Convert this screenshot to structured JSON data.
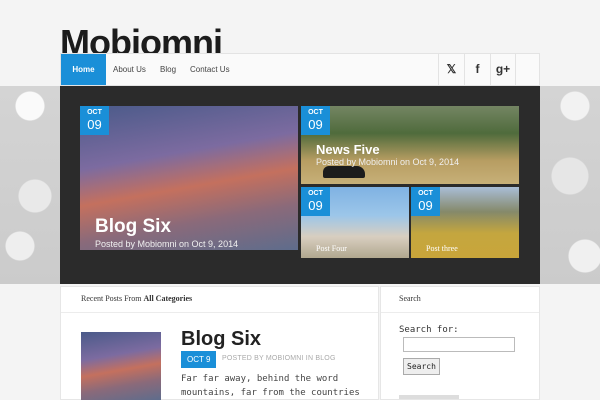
{
  "site": {
    "title": "Mobiomni"
  },
  "nav": {
    "items": [
      "Home",
      "About Us",
      "Blog",
      "Contact Us"
    ]
  },
  "social": {
    "icons": [
      "twitter-icon",
      "facebook-icon",
      "google-plus-icon"
    ],
    "glyphs": [
      "𝕏",
      "f",
      "g+"
    ]
  },
  "colors": {
    "accent": "#1a8fd8",
    "slider_bg": "#2b2b2b"
  },
  "slider": {
    "main": {
      "month": "OCT",
      "day": "09",
      "title": "Blog Six",
      "meta": "Posted by Mobiomni on Oct 9, 2014"
    },
    "top_right": {
      "month": "OCT",
      "day": "09",
      "title": "News Five",
      "meta": "Posted by Mobiomni on Oct 9, 2014"
    },
    "bottom_left": {
      "month": "OCT",
      "day": "09",
      "title": "Post Four"
    },
    "bottom_right": {
      "month": "OCT",
      "day": "09",
      "title": "Post three"
    }
  },
  "recent": {
    "heading_prefix": "Recent Posts From ",
    "heading_bold": "All Categories",
    "post": {
      "title": "Blog Six",
      "date": "OCT 9",
      "meta": "POSTED BY MOBIOMNI IN BLOG",
      "excerpt": "Far far away, behind the word mountains, far from the countries"
    }
  },
  "sidebar": {
    "heading": "Search",
    "search_label": "Search for:",
    "search_value": "",
    "search_button": "Search"
  }
}
